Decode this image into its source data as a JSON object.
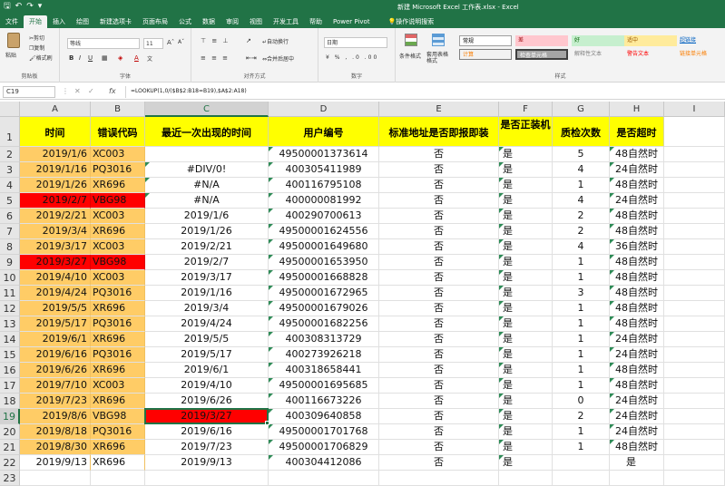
{
  "window": {
    "title": "新建 Microsoft Excel 工作表.xlsx - Excel"
  },
  "tabs": [
    "文件",
    "开始",
    "插入",
    "绘图",
    "新建选项卡",
    "页面布局",
    "公式",
    "数据",
    "审阅",
    "视图",
    "开发工具",
    "帮助",
    "Power Pivot"
  ],
  "tell_me": "操作说明搜索",
  "ribbon": {
    "clipboard": {
      "paste": "粘贴",
      "cut": "剪切",
      "copy": "复制",
      "format_painter": "格式刷",
      "label": "剪贴板"
    },
    "font": {
      "name": "等线",
      "size": "11",
      "label": "字体"
    },
    "alignment": {
      "wrap": "自动换行",
      "merge": "合并后居中",
      "label": "对齐方式"
    },
    "number": {
      "format": "日期",
      "label": "数字"
    },
    "styles": {
      "conditional": "条件格式",
      "table": "套用表格格式",
      "label": "样式",
      "items": [
        {
          "text": "常规",
          "bg": "#ffffff",
          "fg": "#000000"
        },
        {
          "text": "差",
          "bg": "#ffc7ce",
          "fg": "#9c0006"
        },
        {
          "text": "好",
          "bg": "#c6efce",
          "fg": "#006100"
        },
        {
          "text": "适中",
          "bg": "#ffeb9c",
          "fg": "#9c5700"
        },
        {
          "text": "超链接",
          "bg": "#f3f3f3",
          "fg": "#0563c1"
        },
        {
          "text": "计算",
          "bg": "#f2f2f2",
          "fg": "#fa7d00"
        },
        {
          "text": "检查单元格",
          "bg": "#a5a5a5",
          "fg": "#ffffff"
        },
        {
          "text": "解释性文本",
          "bg": "#f3f3f3",
          "fg": "#7f7f7f"
        },
        {
          "text": "警告文本",
          "bg": "#f3f3f3",
          "fg": "#ff0000"
        },
        {
          "text": "链接单元格",
          "bg": "#f3f3f3",
          "fg": "#fa7d00"
        }
      ]
    }
  },
  "formula_bar": {
    "name_box": "C19",
    "formula": "=LOOKUP(1,0/($B$2:B18=B19),$A$2:A18)"
  },
  "columns": [
    "A",
    "B",
    "C",
    "D",
    "E",
    "F",
    "G",
    "H",
    "I"
  ],
  "header_row": [
    "时间",
    "错误代码",
    "最近一次出现的时间",
    "用户编号",
    "标准地址是否即报即装",
    "是否正装机",
    "质检次数",
    "是否超时"
  ],
  "rows": [
    {
      "a": "2019/1/6",
      "b": "XC003",
      "c": "",
      "d": "49500001373614",
      "e": "否",
      "f": "是",
      "g": "5",
      "h": "48自然时"
    },
    {
      "a": "2019/1/16",
      "b": "PQ3016",
      "c": "#DIV/0!",
      "d": "400305411989",
      "e": "否",
      "f": "是",
      "g": "4",
      "h": "24自然时"
    },
    {
      "a": "2019/1/26",
      "b": "XR696",
      "c": "#N/A",
      "d": "400116795108",
      "e": "否",
      "f": "是",
      "g": "1",
      "h": "48自然时"
    },
    {
      "a": "2019/2/7",
      "b": "VBG98",
      "c": "#N/A",
      "d": "400000081992",
      "e": "否",
      "f": "是",
      "g": "4",
      "h": "24自然时"
    },
    {
      "a": "2019/2/21",
      "b": "XC003",
      "c": "2019/1/6",
      "d": "400290700613",
      "e": "否",
      "f": "是",
      "g": "2",
      "h": "48自然时"
    },
    {
      "a": "2019/3/4",
      "b": "XR696",
      "c": "2019/1/26",
      "d": "49500001624556",
      "e": "否",
      "f": "是",
      "g": "2",
      "h": "48自然时"
    },
    {
      "a": "2019/3/17",
      "b": "XC003",
      "c": "2019/2/21",
      "d": "49500001649680",
      "e": "否",
      "f": "是",
      "g": "4",
      "h": "36自然时"
    },
    {
      "a": "2019/3/27",
      "b": "VBG98",
      "c": "2019/2/7",
      "d": "49500001653950",
      "e": "否",
      "f": "是",
      "g": "1",
      "h": "48自然时"
    },
    {
      "a": "2019/4/10",
      "b": "XC003",
      "c": "2019/3/17",
      "d": "49500001668828",
      "e": "否",
      "f": "是",
      "g": "1",
      "h": "48自然时"
    },
    {
      "a": "2019/4/24",
      "b": "PQ3016",
      "c": "2019/1/16",
      "d": "49500001672965",
      "e": "否",
      "f": "是",
      "g": "3",
      "h": "48自然时"
    },
    {
      "a": "2019/5/5",
      "b": "XR696",
      "c": "2019/3/4",
      "d": "49500001679026",
      "e": "否",
      "f": "是",
      "g": "1",
      "h": "48自然时"
    },
    {
      "a": "2019/5/17",
      "b": "PQ3016",
      "c": "2019/4/24",
      "d": "49500001682256",
      "e": "否",
      "f": "是",
      "g": "1",
      "h": "48自然时"
    },
    {
      "a": "2019/6/1",
      "b": "XR696",
      "c": "2019/5/5",
      "d": "400308313729",
      "e": "否",
      "f": "是",
      "g": "1",
      "h": "24自然时"
    },
    {
      "a": "2019/6/16",
      "b": "PQ3016",
      "c": "2019/5/17",
      "d": "400273926218",
      "e": "否",
      "f": "是",
      "g": "1",
      "h": "24自然时"
    },
    {
      "a": "2019/6/26",
      "b": "XR696",
      "c": "2019/6/1",
      "d": "400318658441",
      "e": "否",
      "f": "是",
      "g": "1",
      "h": "48自然时"
    },
    {
      "a": "2019/7/10",
      "b": "XC003",
      "c": "2019/4/10",
      "d": "49500001695685",
      "e": "否",
      "f": "是",
      "g": "1",
      "h": "48自然时"
    },
    {
      "a": "2019/7/23",
      "b": "XR696",
      "c": "2019/6/26",
      "d": "400116673226",
      "e": "否",
      "f": "是",
      "g": "0",
      "h": "24自然时"
    },
    {
      "a": "2019/8/6",
      "b": "VBG98",
      "c": "2019/3/27",
      "d": "400309640858",
      "e": "否",
      "f": "是",
      "g": "2",
      "h": "24自然时"
    },
    {
      "a": "2019/8/18",
      "b": "PQ3016",
      "c": "2019/6/16",
      "d": "49500001701768",
      "e": "否",
      "f": "是",
      "g": "1",
      "h": "24自然时"
    },
    {
      "a": "2019/8/30",
      "b": "XR696",
      "c": "2019/7/23",
      "d": "49500001706829",
      "e": "否",
      "f": "是",
      "g": "1",
      "h": "48自然时"
    },
    {
      "a": "2019/9/13",
      "b": "XR696",
      "c": "2019/9/13",
      "d": "400304412086",
      "e": "否",
      "f": "是",
      "g": "",
      "h": "是"
    }
  ],
  "row_numbers": [
    "1",
    "2",
    "3",
    "4",
    "5",
    "6",
    "7",
    "8",
    "9",
    "10",
    "11",
    "12",
    "13",
    "14",
    "15",
    "16",
    "17",
    "18",
    "19",
    "20",
    "21",
    "22",
    "23"
  ],
  "colors": {
    "header_fill": "#ffff00",
    "ab_fill": "#ffcc66",
    "highlight_red": "#ff0000",
    "excel_green": "#217346"
  }
}
